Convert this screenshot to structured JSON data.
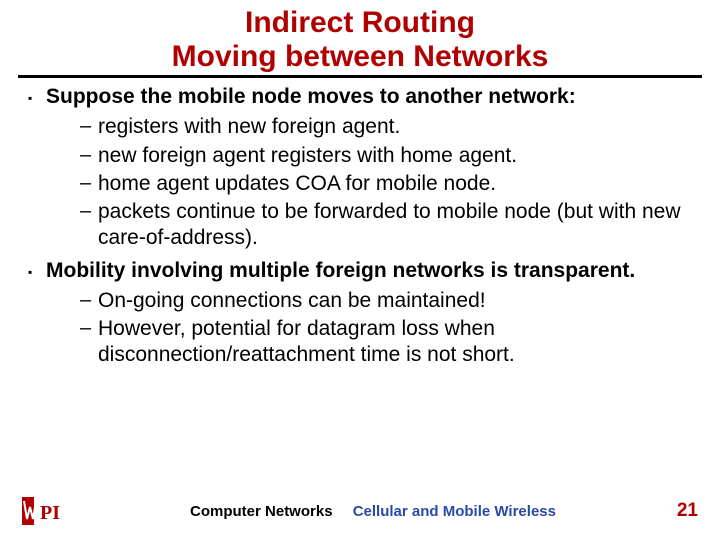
{
  "title_line1": "Indirect Routing",
  "title_line2": "Moving between Networks",
  "bullets": {
    "b1": "Suppose the mobile node moves to another network:",
    "b1_subs": {
      "s1": "registers with new foreign agent.",
      "s2": "new foreign agent registers with home agent.",
      "s3": "home agent updates COA for mobile node.",
      "s4": "packets continue to be forwarded to mobile node (but with new care-of-address)."
    },
    "b2": "Mobility involving multiple foreign networks is transparent.",
    "b2_subs": {
      "s1": "On-going connections can be maintained!",
      "s2": "However, potential for datagram loss when disconnection/reattachment time is not short."
    }
  },
  "footer": {
    "left_logo_text": "WPI",
    "center1": "Computer Networks",
    "center2": "Cellular and Mobile Wireless",
    "page": "21"
  },
  "bullet_glyph": "▪",
  "dash_glyph": "–"
}
